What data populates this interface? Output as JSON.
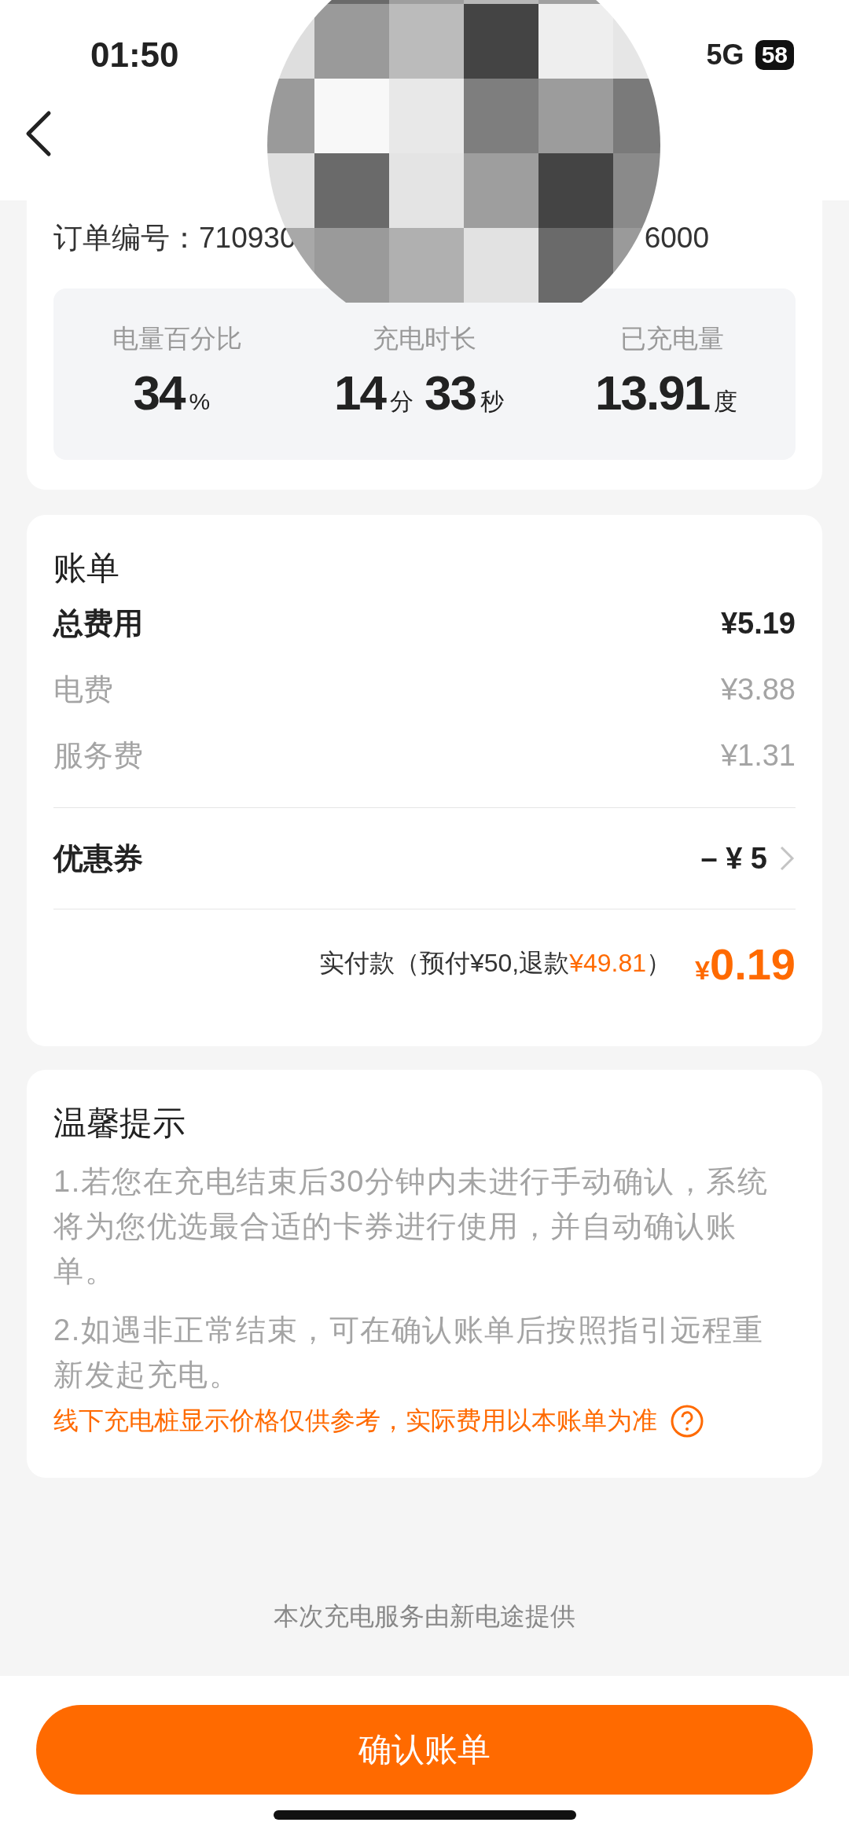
{
  "status_bar": {
    "time": "01:50",
    "network": "5G",
    "battery": "58"
  },
  "order": {
    "label": "订单编号：710930",
    "tail": "6000"
  },
  "stats": [
    {
      "label": "电量百分比",
      "parts": [
        {
          "value": "34",
          "unit": "%"
        }
      ]
    },
    {
      "label": "充电时长",
      "parts": [
        {
          "value": "14",
          "unit": "分"
        },
        {
          "value": "33",
          "unit": "秒"
        }
      ]
    },
    {
      "label": "已充电量",
      "parts": [
        {
          "value": "13.91",
          "unit": "度"
        }
      ]
    }
  ],
  "bill": {
    "title": "账单",
    "lines": [
      {
        "label": "总费用",
        "amount": "¥5.19",
        "kind": "total"
      },
      {
        "label": "电费",
        "amount": "¥3.88",
        "kind": "sub"
      },
      {
        "label": "服务费",
        "amount": "¥1.31",
        "kind": "sub"
      }
    ],
    "coupon": {
      "label": "优惠券",
      "amount": "– ¥ 5"
    },
    "paid": {
      "prefix": "实付款（预付¥50,退款",
      "refund": "¥49.81",
      "suffix": "）",
      "currency": "¥",
      "amount": "0.19"
    }
  },
  "tips": {
    "title": "温馨提示",
    "items": [
      "1.若您在充电结束后30分钟内未进行手动确认，系统将为您优选最合适的卡券进行使用，并自动确认账单。",
      "2.如遇非正常结束，可在确认账单后按照指引远程重新发起充电。"
    ],
    "notice": "线下充电桩显示价格仅供参考，实际费用以本账单为准"
  },
  "footer": "本次充电服务由新电途提供",
  "confirm_button": "确认账单"
}
